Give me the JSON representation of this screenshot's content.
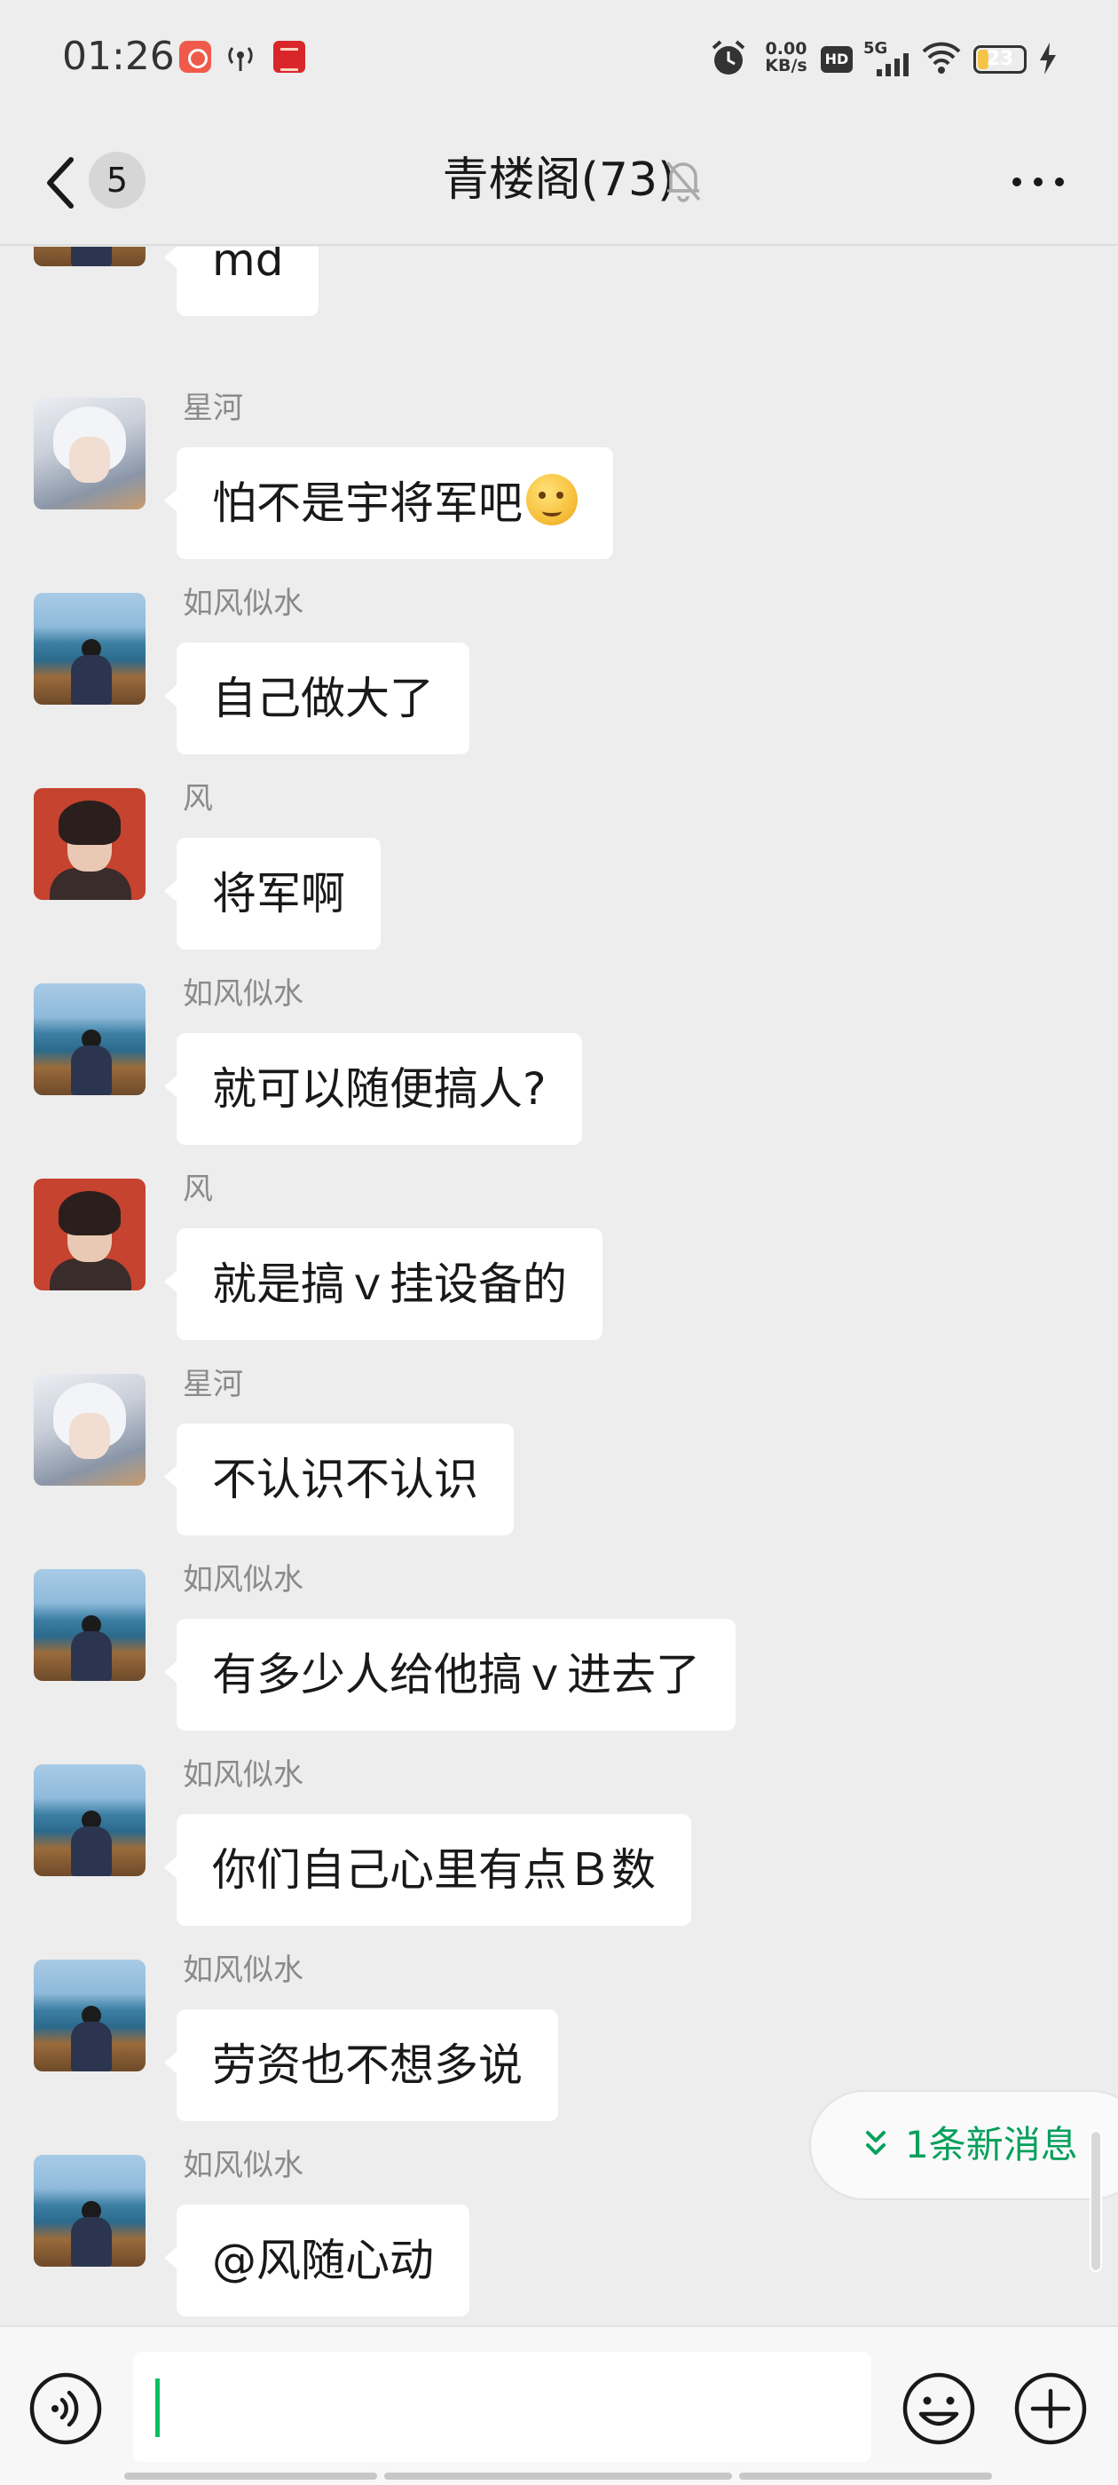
{
  "status_bar": {
    "time": "01:26",
    "net_speed_value": "0.00",
    "net_speed_unit": "KB/s",
    "hd": "HD",
    "network": "5G",
    "battery_level": "23",
    "battery_fraction": 0.23
  },
  "header": {
    "back_unread": "5",
    "title": "青楼阁(73)"
  },
  "messages": [
    {
      "sender": "",
      "avatar": "lake",
      "text": "md"
    },
    {
      "sender": "星河",
      "avatar": "anime",
      "text": "怕不是宇将军吧"
    },
    {
      "sender": "如风似水",
      "avatar": "lake",
      "text": "自己做大了"
    },
    {
      "sender": "风",
      "avatar": "red",
      "text": "将军啊"
    },
    {
      "sender": "如风似水",
      "avatar": "lake",
      "text": "就可以随便搞人?"
    },
    {
      "sender": "风",
      "avatar": "red",
      "text": "就是搞ｖ挂设备的"
    },
    {
      "sender": "星河",
      "avatar": "anime",
      "text": "不认识不认识"
    },
    {
      "sender": "如风似水",
      "avatar": "lake",
      "text": "有多少人给他搞ｖ进去了"
    },
    {
      "sender": "如风似水",
      "avatar": "lake",
      "text": "你们自己心里有点Ｂ数"
    },
    {
      "sender": "如风似水",
      "avatar": "lake",
      "text": "劳资也不想多说"
    },
    {
      "sender": "如风似水",
      "avatar": "lake",
      "text": "@风随心动"
    }
  ],
  "new_messages_label": "1条新消息",
  "input": {
    "value": ""
  },
  "colors": {
    "background": "#ededed",
    "accent_green": "#07c160",
    "bubble": "#ffffff"
  }
}
